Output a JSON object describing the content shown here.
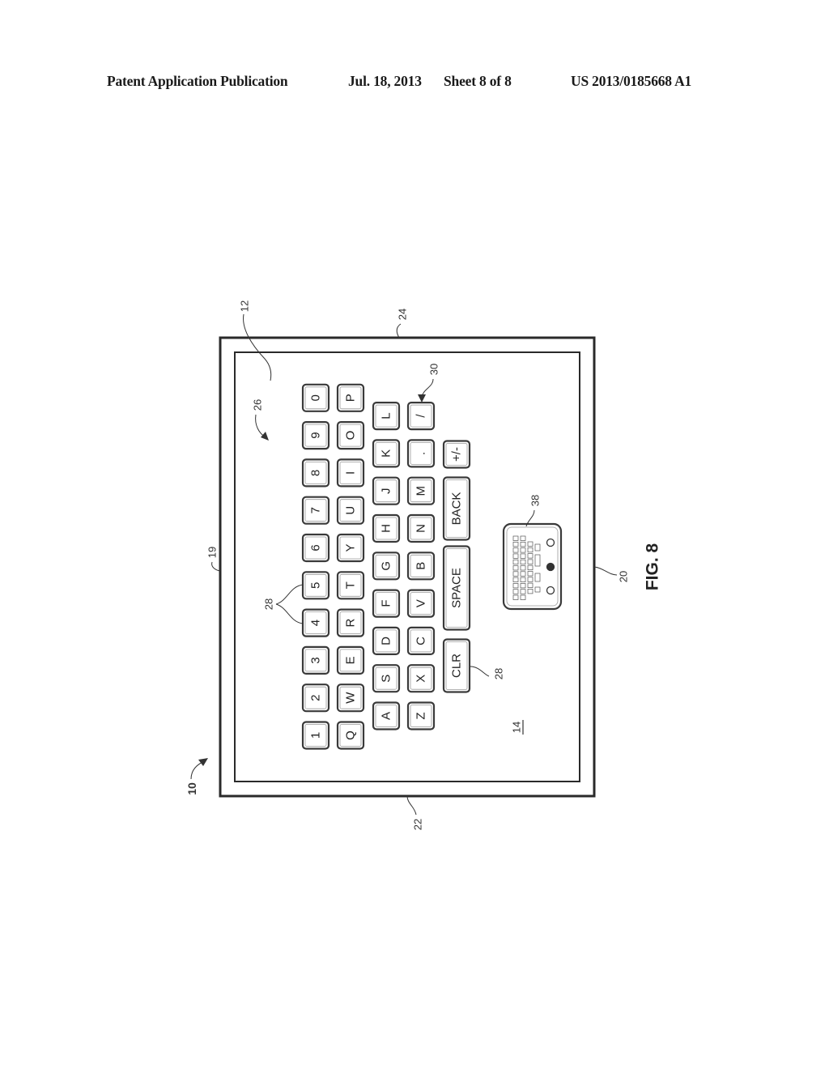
{
  "header": {
    "publication": "Patent Application Publication",
    "date": "Jul. 18, 2013",
    "sheet": "Sheet 8 of 8",
    "number": "US 2013/0185668 A1"
  },
  "figure": {
    "label": "FIG. 8",
    "orientation": "rotated 90 degrees counterclockwise",
    "reference_numerals": {
      "device": "10",
      "display": "12",
      "screen_area": "14",
      "side_left": "19",
      "side_right": "20",
      "side_bottom": "22",
      "side_top": "24",
      "keyboard": "26",
      "keys": "28",
      "key_slash": "30",
      "handheld_device": "38"
    },
    "keyboard": {
      "number_row": [
        "1",
        "2",
        "3",
        "4",
        "5",
        "6",
        "7",
        "8",
        "9",
        "0"
      ],
      "top_row": [
        "Q",
        "W",
        "E",
        "R",
        "T",
        "Y",
        "U",
        "I",
        "O",
        "P"
      ],
      "home_row": [
        "A",
        "S",
        "D",
        "F",
        "G",
        "H",
        "J",
        "K",
        "L"
      ],
      "bottom_row": [
        "Z",
        "X",
        "C",
        "V",
        "B",
        "N",
        "M",
        ".",
        "/"
      ],
      "function_row": [
        "CLR",
        "SPACE",
        "BACK",
        "+/-"
      ]
    }
  }
}
